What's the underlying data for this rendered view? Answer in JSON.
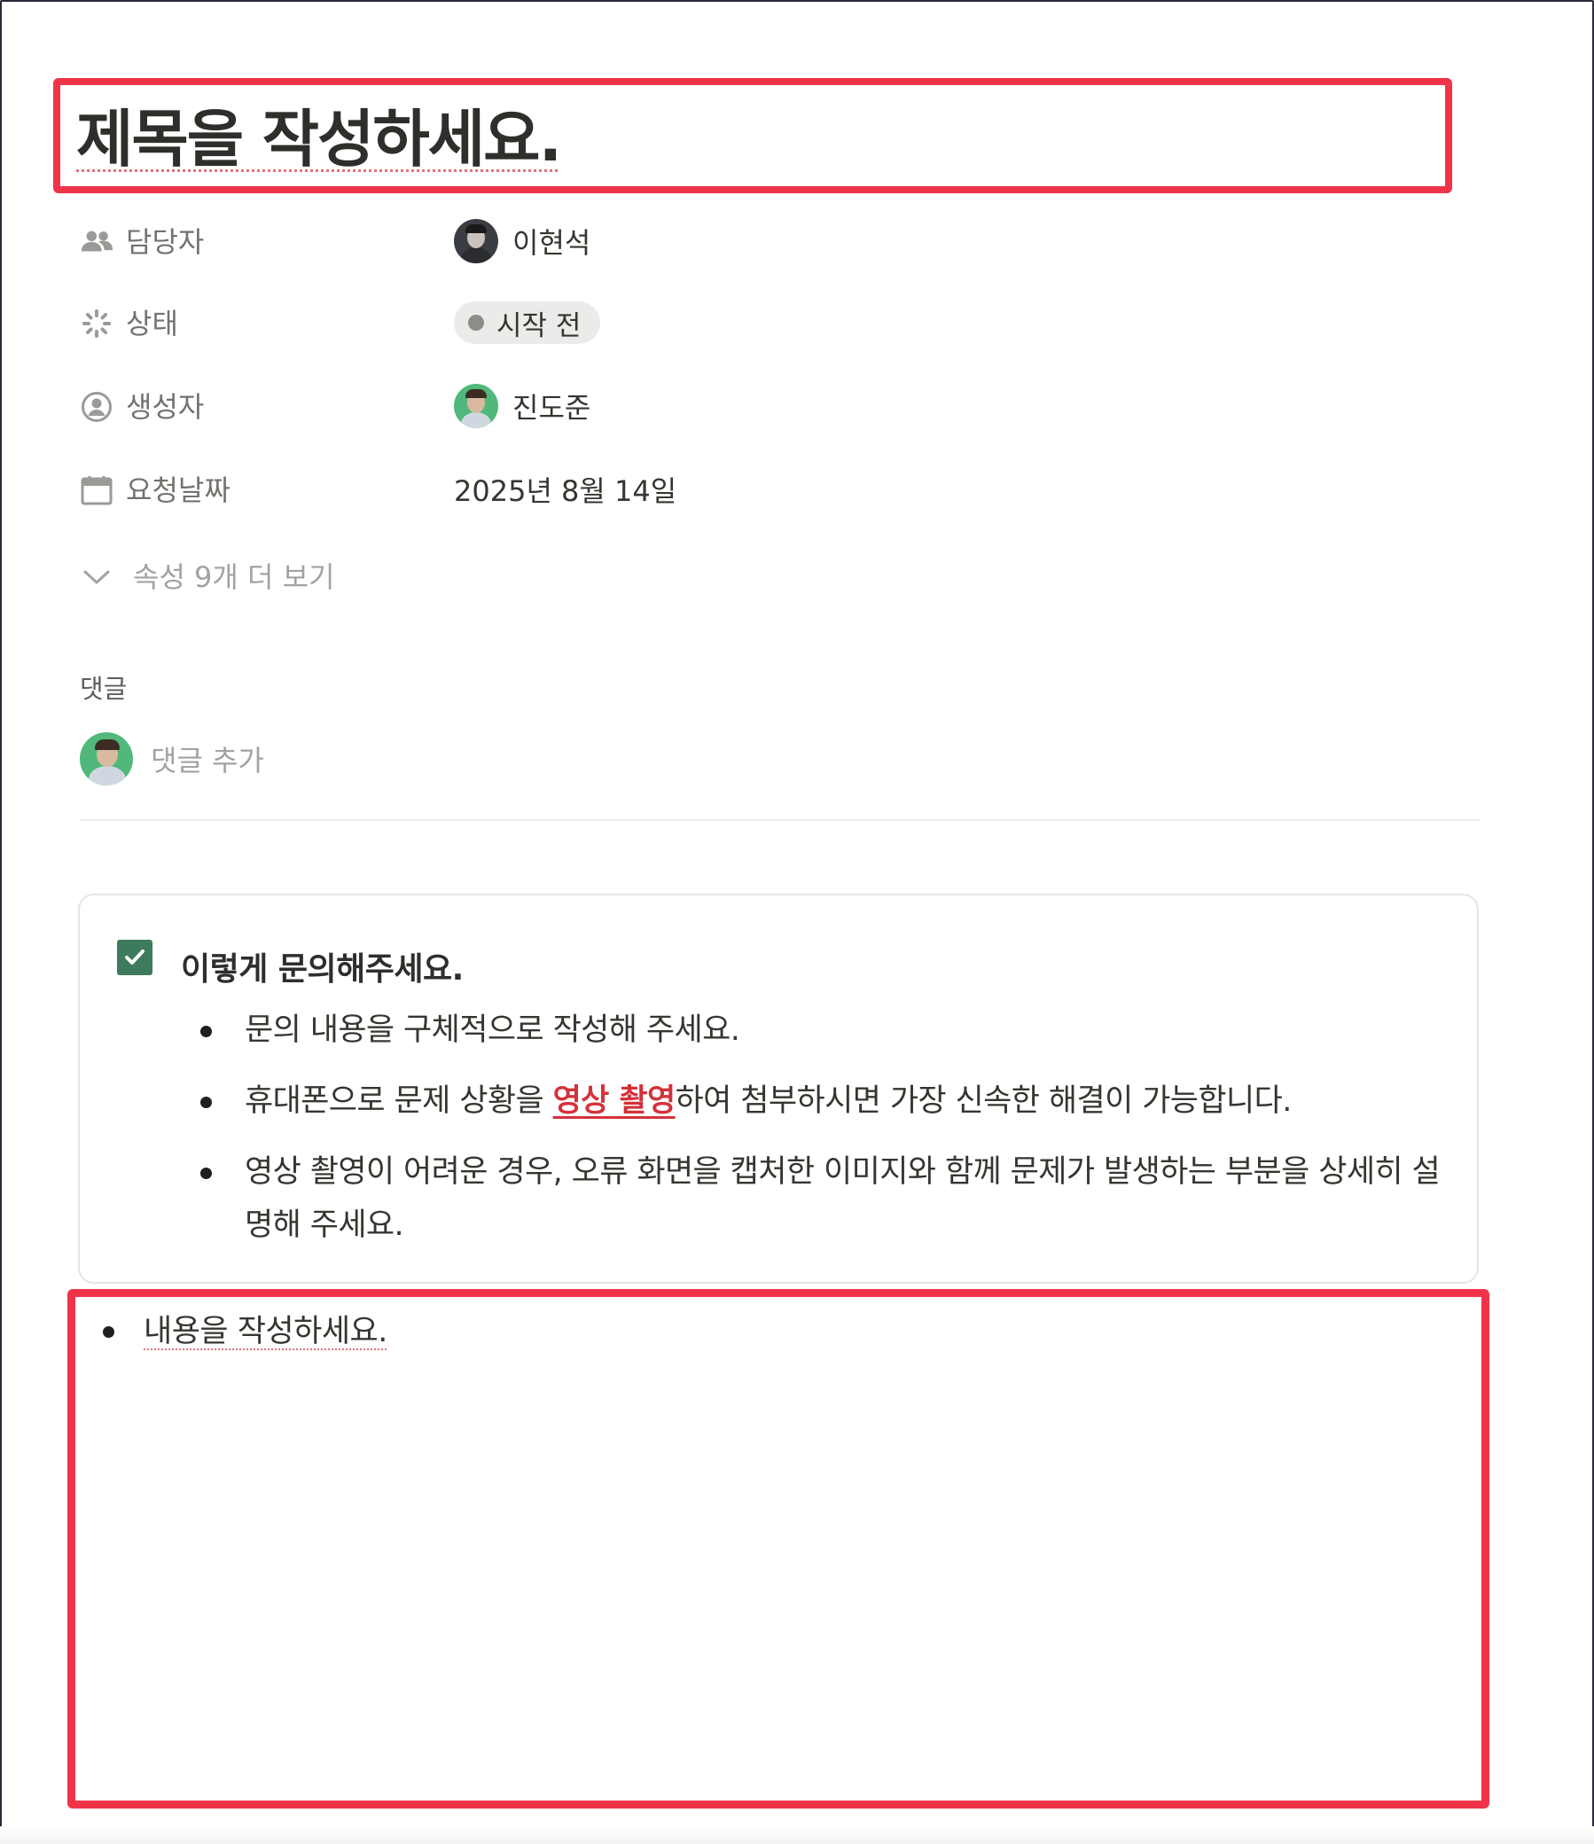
{
  "page": {
    "title": "제목을 작성하세요."
  },
  "properties": [
    {
      "icon": "people-icon",
      "label": "담당자",
      "value": "이현석",
      "type": "person"
    },
    {
      "icon": "status-spinner-icon",
      "label": "상태",
      "value": "시작 전",
      "type": "status"
    },
    {
      "icon": "user-circle-icon",
      "label": "생성자",
      "value": "진도준",
      "type": "person"
    },
    {
      "icon": "calendar-icon",
      "label": "요청날짜",
      "value": "2025년 8월 14일",
      "type": "date"
    }
  ],
  "more_properties_label": "속성 9개 더 보기",
  "comments": {
    "title": "댓글",
    "placeholder": "댓글 추가"
  },
  "callout": {
    "icon": "checkbox-checked-icon",
    "heading": "이렇게 문의해주세요.",
    "items": [
      {
        "text": "문의 내용을 구체적으로 작성해 주세요."
      },
      {
        "pre": "휴대폰으로 문제 상황을 ",
        "emphasis": "영상 촬영",
        "post": "하여 첨부하시면 가장 신속한 해결이 가능합니다."
      },
      {
        "text": "영상 촬영이 어려운 경우, 오류 화면을 캡처한 이미지와 함께 문제가 발생하는 부분을 상세히 설명해 주세요."
      }
    ]
  },
  "content": {
    "items": [
      "내용을 작성하세요."
    ]
  },
  "colors": {
    "highlight": "#f1334a",
    "emphasis": "#d4323a",
    "checkbox": "#3e7a5c"
  }
}
